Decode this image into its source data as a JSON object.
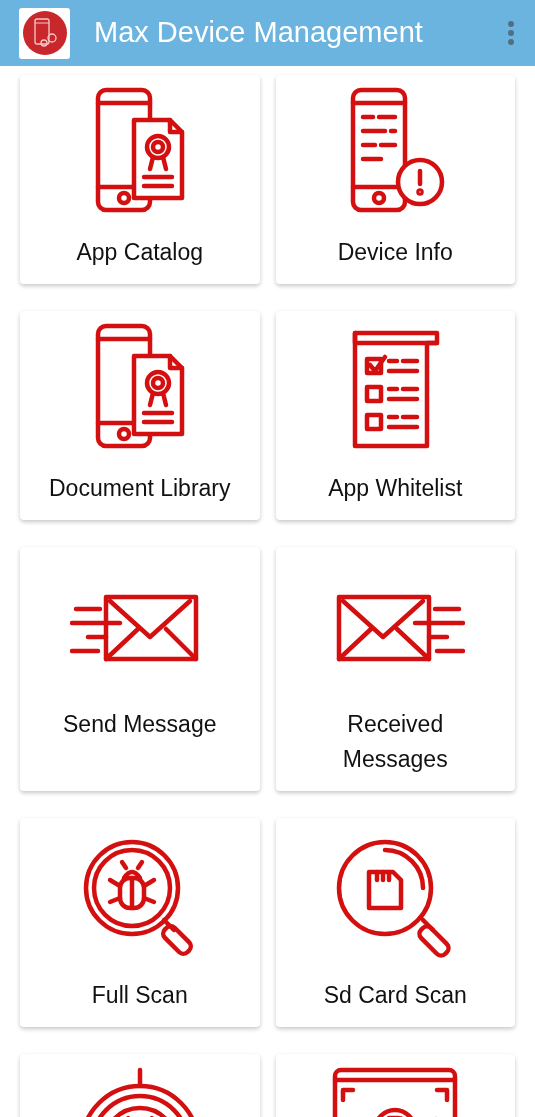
{
  "app_bar": {
    "title": "Max Device Management"
  },
  "tiles": [
    {
      "label": "App Catalog",
      "kind": "phone-certificate"
    },
    {
      "label": "Device Info",
      "kind": "phone-info"
    },
    {
      "label": "Document Library",
      "kind": "phone-certificate"
    },
    {
      "label": "App Whitelist",
      "kind": "checklist"
    },
    {
      "label": "Send Message",
      "kind": "send-mail"
    },
    {
      "label": "Received Messages",
      "kind": "receive-mail"
    },
    {
      "label": "Full Scan",
      "kind": "bug-magnifier"
    },
    {
      "label": "Sd Card Scan",
      "kind": "sd-magnifier"
    },
    {
      "kind": "bug-target"
    },
    {
      "kind": "bitcoin-screen"
    }
  ]
}
